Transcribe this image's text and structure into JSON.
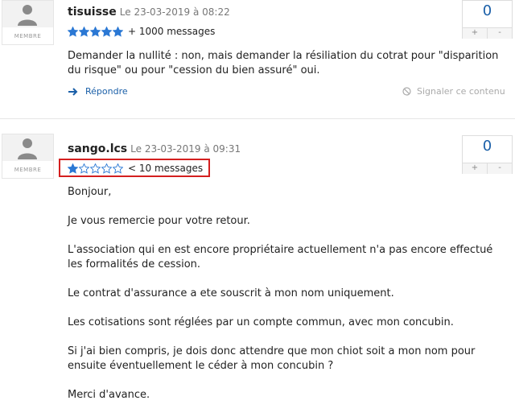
{
  "posts": [
    {
      "author": "tisuisse",
      "date": "Le 23-03-2019 à 08:22",
      "role": "MEMBRE",
      "rating_stars": 5,
      "message_count": "+ 1000 messages",
      "votes": "0",
      "vote_plus": "+",
      "vote_minus": "-",
      "paragraphs": [
        "Demander la nullité : non, mais demander la résiliation du cotrat pour \"disparition du risque\" ou pour \"cession du bien assuré\" oui."
      ],
      "reply_label": "Répondre",
      "report_label": "Signaler ce contenu"
    },
    {
      "author": "sango.lcs",
      "date": "Le 23-03-2019 à 09:31",
      "role": "MEMBRE",
      "rating_stars": 1,
      "message_count": "< 10 messages",
      "votes": "0",
      "vote_plus": "+",
      "vote_minus": "-",
      "paragraphs": [
        "Bonjour,",
        "Je vous remercie pour votre retour.",
        "L'association qui en est encore propriétaire actuellement n'a pas encore effectué les formalités de cession.",
        "Le contrat d'assurance a ete souscrit à mon nom uniquement.",
        "Les cotisations sont réglées par un compte commun, avec mon concubin.",
        "Si j'ai bien compris, je dois donc attendre que mon chiot soit a mon nom pour ensuite éventuellement le céder à mon concubin ?",
        "Merci d'avance."
      ]
    }
  ],
  "colors": {
    "accent": "#1a5fa8",
    "highlight": "#d41f1f",
    "star_filled": "#2b78d4"
  },
  "icons": {
    "avatar": "user-silhouette-icon",
    "star": "star-icon",
    "reply": "reply-arrow-icon",
    "report": "prohibited-icon"
  }
}
